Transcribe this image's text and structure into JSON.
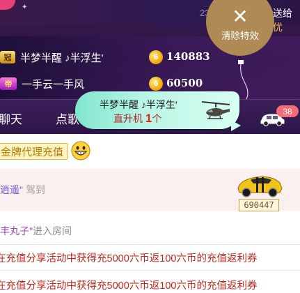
{
  "header": {
    "online_count": "23",
    "gift_label": "送给 ",
    "gift_label_cut": "优"
  },
  "clear_effects": {
    "icon": "close-icon",
    "label": "清除特效"
  },
  "rank": [
    {
      "badge": "冠",
      "name": "半梦半醒 ♪半浮生'",
      "coins": "140883"
    },
    {
      "badge": "帝",
      "name": "一手云一手风",
      "coins": "60500"
    }
  ],
  "coin_symbol": "6",
  "tabs": [
    {
      "label": "聊天"
    },
    {
      "label": "点歌"
    }
  ],
  "notice_count": "38",
  "gift_popup": {
    "sender": "半梦半醒 ♪半浮生'",
    "gift_name": "直升机",
    "count": "1",
    "unit": "个",
    "icon": "helicopter-icon"
  },
  "chat": {
    "agent_button": "金牌代理充值",
    "drive": {
      "user": "逍遥",
      "open_quote": "\"",
      "close_quote": "\"",
      "suffix": " 驾到"
    },
    "car_id": "690447",
    "enter": {
      "user": "丰丸子",
      "close_quote": "\"",
      "suffix": "进入房间"
    },
    "system_messages": [
      "在充值分享活动中获得充5000六币返100六币的充值返利券",
      "在充值分享活动中获得充5000六币返100六币的充值返利券"
    ]
  }
}
